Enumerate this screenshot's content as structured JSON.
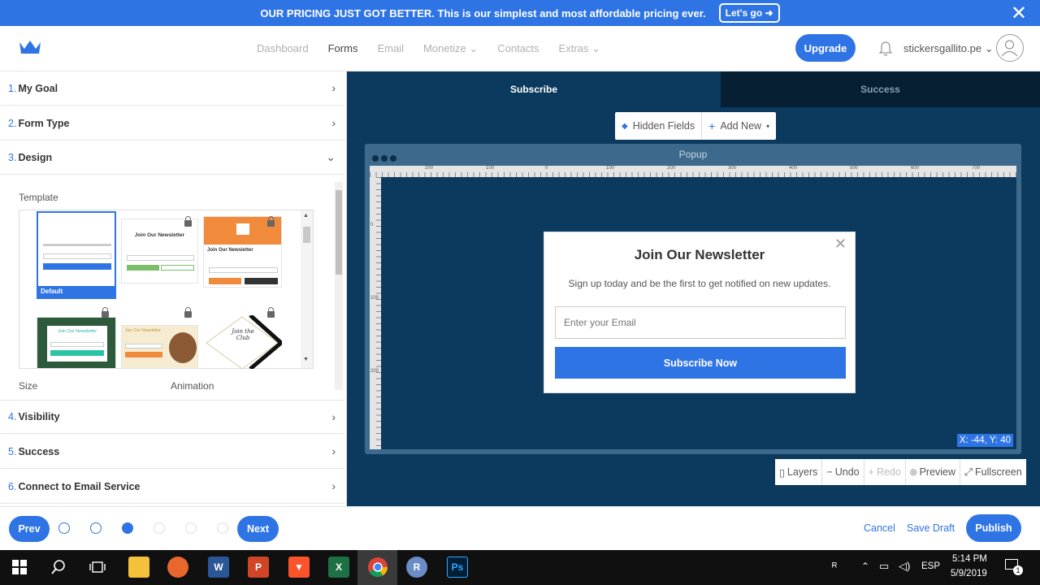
{
  "banner": {
    "text": "OUR PRICING JUST GOT BETTER. This is our simplest and most affordable pricing ever.",
    "cta": "Let's go ➜",
    "close": "✕"
  },
  "nav": {
    "links": [
      "Dashboard",
      "Forms",
      "Email",
      "Monetize ⌄",
      "Contacts",
      "Extras ⌄"
    ],
    "active": "Forms",
    "upgrade": "Upgrade",
    "username": "stickersgallito.pe ⌄"
  },
  "steps": [
    {
      "num": "1.",
      "label": "My Goal",
      "chev": "›"
    },
    {
      "num": "2.",
      "label": "Form Type",
      "chev": "›"
    },
    {
      "num": "3.",
      "label": "Design",
      "chev": "⌄"
    },
    {
      "num": "4.",
      "label": "Visibility",
      "chev": "›"
    },
    {
      "num": "5.",
      "label": "Success",
      "chev": "›"
    },
    {
      "num": "6.",
      "label": "Connect to Email Service",
      "chev": "›"
    }
  ],
  "design": {
    "template_label": "Template",
    "size_label": "Size",
    "animation_label": "Animation",
    "templates": [
      {
        "title": "",
        "badge": "Default",
        "selected": true
      },
      {
        "title": "Join Our Newsletter",
        "locked": true
      },
      {
        "title": "Join Our Newsletter",
        "locked": true
      },
      {
        "title": "Join Our Newsletter",
        "locked": true
      },
      {
        "title": "Join Our Newsletter",
        "locked": true
      },
      {
        "title": "Join the Club",
        "locked": true
      }
    ]
  },
  "editor": {
    "tabs": [
      "Subscribe",
      "Success"
    ],
    "active_tab": "Subscribe",
    "hidden_fields": "Hidden Fields",
    "add_new": "Add New",
    "canvas_title": "Popup",
    "ruler_h": [
      "200",
      "100",
      "0",
      "100",
      "200",
      "300",
      "400",
      "500",
      "600",
      "700"
    ],
    "ruler_v": [
      "0",
      "100",
      "200"
    ],
    "coords": "X: -44, Y: 40",
    "popup": {
      "close": "✕",
      "title": "Join Our Newsletter",
      "subtitle": "Sign up today and be the first to get notified on new updates.",
      "email_placeholder": "Enter your Email",
      "button": "Subscribe Now"
    },
    "bottom_tools": [
      {
        "label": "Layers",
        "icon": "▯",
        "disabled": false
      },
      {
        "label": "Undo",
        "icon": "−",
        "disabled": false
      },
      {
        "label": "Redo",
        "icon": "+",
        "disabled": true
      },
      {
        "label": "Preview",
        "icon": "◎",
        "disabled": false
      },
      {
        "label": "Fullscreen",
        "icon": "⤢",
        "disabled": false
      }
    ]
  },
  "footer": {
    "prev": "Prev",
    "next": "Next",
    "cancel": "Cancel",
    "save_draft": "Save Draft",
    "publish": "Publish",
    "current_step": 3,
    "total_steps": 6
  },
  "taskbar": {
    "lang": "ESP",
    "time": "5:14 PM",
    "date": "5/9/2019",
    "notif": "1"
  },
  "colors": {
    "primary": "#2f74e5",
    "editor_bg": "#0b3a5e",
    "tab_inactive": "#061f33"
  }
}
